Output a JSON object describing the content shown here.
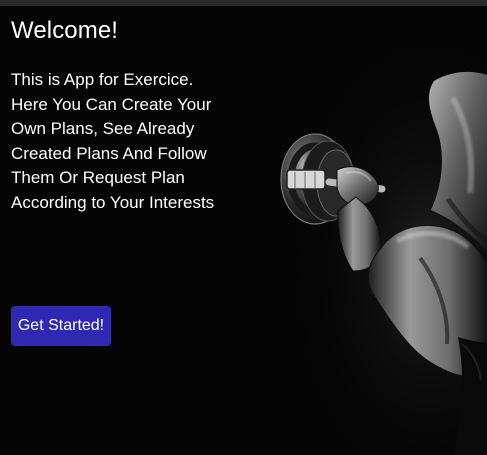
{
  "welcome": {
    "title": "Welcome!",
    "description": "This is App for Exercice. Here You Can Create Your Own Plans, See Already Created Plans And Follow Them Or Request Plan According to Your Interests",
    "button_label": "Get Started!"
  },
  "colors": {
    "background": "#050505",
    "button": "#2f28b2",
    "text": "#ffffff"
  },
  "image": {
    "subject": "athlete-with-dumbbell"
  }
}
